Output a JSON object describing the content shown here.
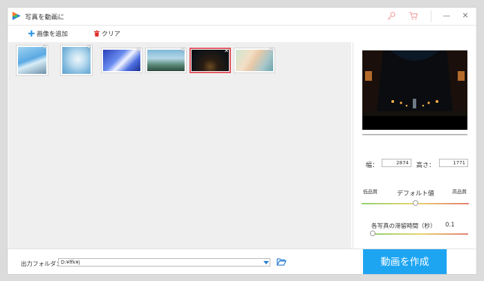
{
  "app": {
    "title": "写真を動画に"
  },
  "toolbar": {
    "add_label": "画像を追加",
    "clear_label": "クリア"
  },
  "gallery": {
    "images": [
      {
        "name": "photo-1",
        "selected": false
      },
      {
        "name": "photo-2",
        "selected": false
      },
      {
        "name": "photo-3",
        "selected": false
      },
      {
        "name": "photo-4",
        "selected": false
      },
      {
        "name": "photo-5",
        "selected": true
      },
      {
        "name": "photo-6",
        "selected": false
      }
    ],
    "close_glyph": "✕"
  },
  "settings": {
    "width_label": "幅：",
    "width_value": "2874",
    "height_label": "高さ：",
    "height_value": "1771",
    "quality_low": "低品質",
    "quality_default": "デフォルト値",
    "quality_high": "高品質",
    "quality_position": 0.5,
    "duration_label": "各写真の滞留時間（秒）",
    "duration_value": "0.1",
    "duration_position": 0.0
  },
  "footer": {
    "output_label": "出力フォルダ：",
    "output_path": "D:¥ffk¥j",
    "create_label": "動画を作成"
  },
  "colors": {
    "accent": "#1ea5f2",
    "selected_border": "#e2555e",
    "clear_icon": "#e0322d",
    "add_icon": "#1e8fe8"
  }
}
